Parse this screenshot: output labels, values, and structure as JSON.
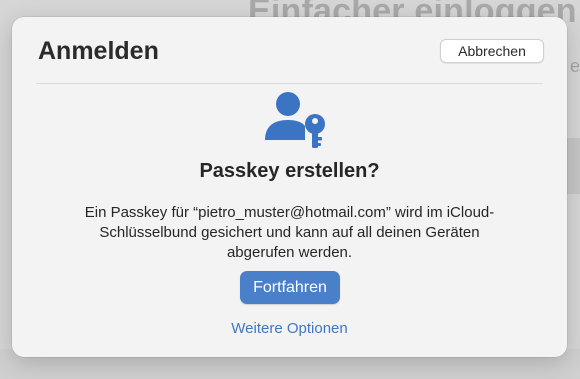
{
  "background": {
    "heading": "Einfacher einloggen",
    "side_letter": "e"
  },
  "sheet": {
    "title": "Anmelden",
    "cancel_label": "Abbrechen",
    "icon": "person-with-key-icon",
    "prompt_title": "Passkey erstellen?",
    "description_line1": "Ein Passkey für “pietro_muster@hotmail.com” wird im iCloud-",
    "description_line2": "Schlüsselbund gesichert und kann auf all deinen Geräten",
    "description_line3": "abgerufen werden.",
    "continue_label": "Fortfahren",
    "more_options_label": "Weitere Optionen"
  },
  "colors": {
    "accent": "#4a80c9",
    "link": "#3f78c1",
    "icon": "#3b74c3"
  }
}
